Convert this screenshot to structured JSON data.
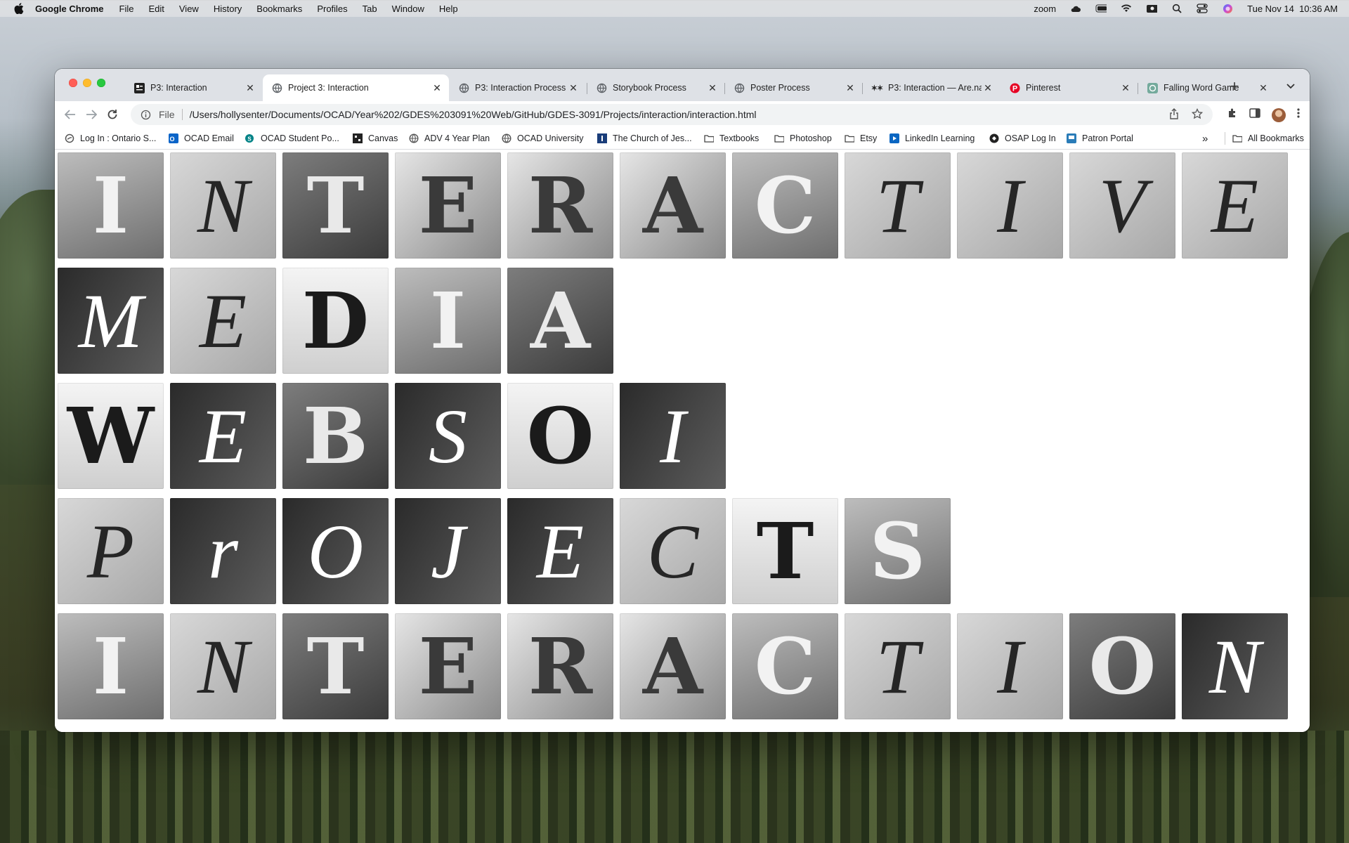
{
  "menubar": {
    "app": "Google Chrome",
    "items": [
      "File",
      "Edit",
      "View",
      "History",
      "Bookmarks",
      "Profiles",
      "Tab",
      "Window",
      "Help"
    ],
    "status": {
      "zoom": "zoom",
      "datetime": "Tue Nov 14  10:36 AM"
    }
  },
  "tabs": [
    {
      "title": "P3: Interaction",
      "favicon": "document-icon",
      "active": false
    },
    {
      "title": "Project 3: Interaction",
      "favicon": "globe-icon",
      "active": true
    },
    {
      "title": "P3: Interaction Process",
      "favicon": "globe-icon",
      "active": false
    },
    {
      "title": "Storybook Process",
      "favicon": "globe-icon",
      "active": false
    },
    {
      "title": "Poster Process",
      "favicon": "globe-icon",
      "active": false
    },
    {
      "title": "P3: Interaction — Are.na",
      "favicon": "arena-icon",
      "active": false
    },
    {
      "title": "Pinterest",
      "favicon": "pinterest-icon",
      "active": false
    },
    {
      "title": "Falling Word Game",
      "favicon": "chatgpt-icon",
      "active": false
    }
  ],
  "toolbar": {
    "scheme": "File",
    "url": "/Users/hollysenter/Documents/OCAD/Year%202/GDES%203091%20Web/GitHub/GDES-3091/Projects/interaction/interaction.html"
  },
  "bookmarks": [
    {
      "label": "Log In : Ontario S...",
      "icon": "swirl-icon"
    },
    {
      "label": "OCAD Email",
      "icon": "outlook-icon"
    },
    {
      "label": "OCAD Student Po...",
      "icon": "sharepoint-icon"
    },
    {
      "label": "Canvas",
      "icon": "canvas-icon"
    },
    {
      "label": "ADV 4 Year Plan",
      "icon": "globe-icon"
    },
    {
      "label": "OCAD University",
      "icon": "globe-icon"
    },
    {
      "label": "The Church of Jes...",
      "icon": "church-icon"
    },
    {
      "label": "Textbooks",
      "icon": "folder-icon"
    },
    {
      "label": "Photoshop",
      "icon": "folder-icon"
    },
    {
      "label": "Etsy",
      "icon": "folder-icon"
    },
    {
      "label": "LinkedIn Learning",
      "icon": "linkedin-icon"
    },
    {
      "label": "OSAP Log In",
      "icon": "osap-icon"
    },
    {
      "label": "Patron Portal",
      "icon": "patron-icon"
    }
  ],
  "bookmarks_more": "»",
  "all_bookmarks": "All Bookmarks",
  "letter_rows": [
    [
      "I",
      "N",
      "T",
      "E",
      "R",
      "A",
      "C",
      "T",
      "I",
      "V",
      "E"
    ],
    [
      "M",
      "E",
      "D",
      "I",
      "A"
    ],
    [
      "W",
      "E",
      "B",
      "S",
      "O",
      "I"
    ],
    [
      "P",
      "r",
      "O",
      "J",
      "E",
      "C",
      "T",
      "S"
    ],
    [
      "I",
      "N",
      "T",
      "E",
      "R",
      "A",
      "C",
      "T",
      "I",
      "O",
      "N"
    ]
  ]
}
